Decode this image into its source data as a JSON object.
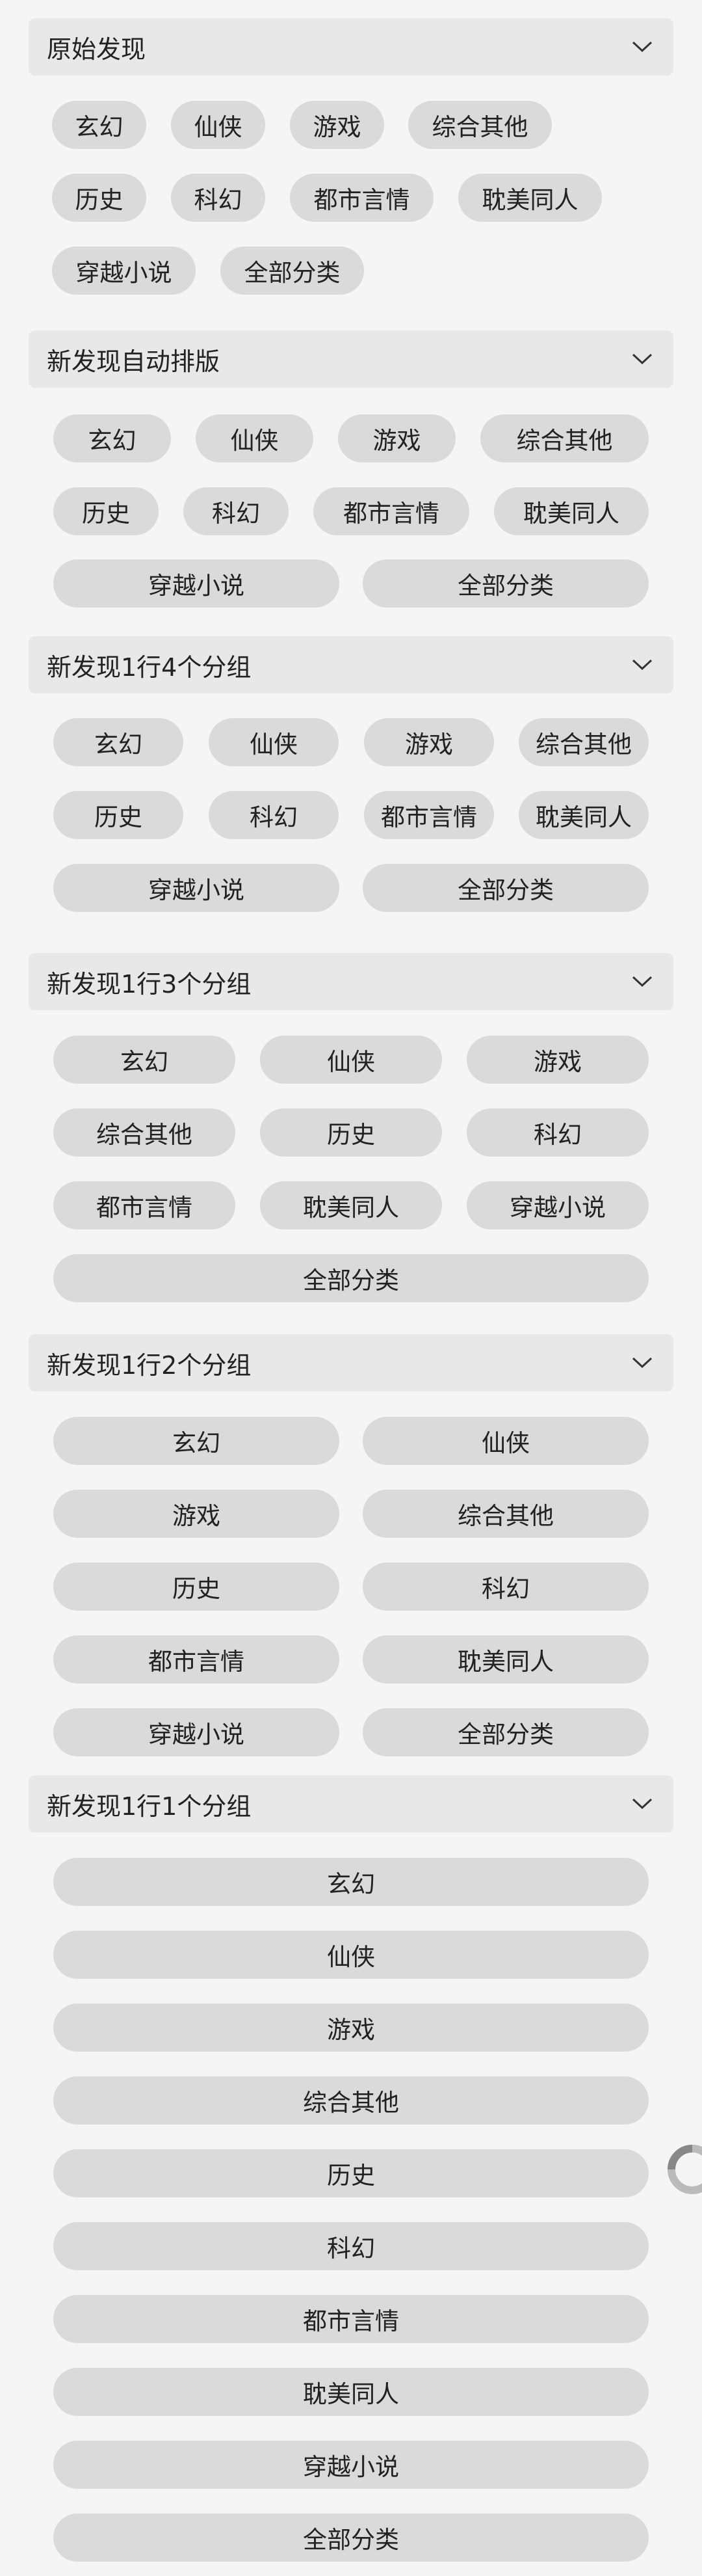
{
  "sections": [
    {
      "title": "原始发现",
      "items": [
        "玄幻",
        "仙侠",
        "游戏",
        "综合其他",
        "历史",
        "科幻",
        "都市言情",
        "耽美同人",
        "穿越小说",
        "全部分类"
      ]
    },
    {
      "title": "新发现自动排版",
      "items": [
        "玄幻",
        "仙侠",
        "游戏",
        "综合其他",
        "历史",
        "科幻",
        "都市言情",
        "耽美同人",
        "穿越小说",
        "全部分类"
      ]
    },
    {
      "title": "新发现1行4个分组",
      "items": [
        "玄幻",
        "仙侠",
        "游戏",
        "综合其他",
        "历史",
        "科幻",
        "都市言情",
        "耽美同人",
        "穿越小说",
        "全部分类"
      ]
    },
    {
      "title": "新发现1行3个分组",
      "items": [
        "玄幻",
        "仙侠",
        "游戏",
        "综合其他",
        "历史",
        "科幻",
        "都市言情",
        "耽美同人",
        "穿越小说",
        "全部分类"
      ]
    },
    {
      "title": "新发现1行2个分组",
      "items": [
        "玄幻",
        "仙侠",
        "游戏",
        "综合其他",
        "历史",
        "科幻",
        "都市言情",
        "耽美同人",
        "穿越小说",
        "全部分类"
      ]
    },
    {
      "title": "新发现1行1个分组",
      "items": [
        "玄幻",
        "仙侠",
        "游戏",
        "综合其他",
        "历史",
        "科幻",
        "都市言情",
        "耽美同人",
        "穿越小说",
        "全部分类"
      ]
    }
  ],
  "icons": {
    "chevron": "chevron-down-icon",
    "spinner": "loading-spinner-icon"
  },
  "colors": {
    "background": "#f5f5f5",
    "header": "#e8e8e8",
    "chip": "#dadada",
    "text": "#222222"
  }
}
